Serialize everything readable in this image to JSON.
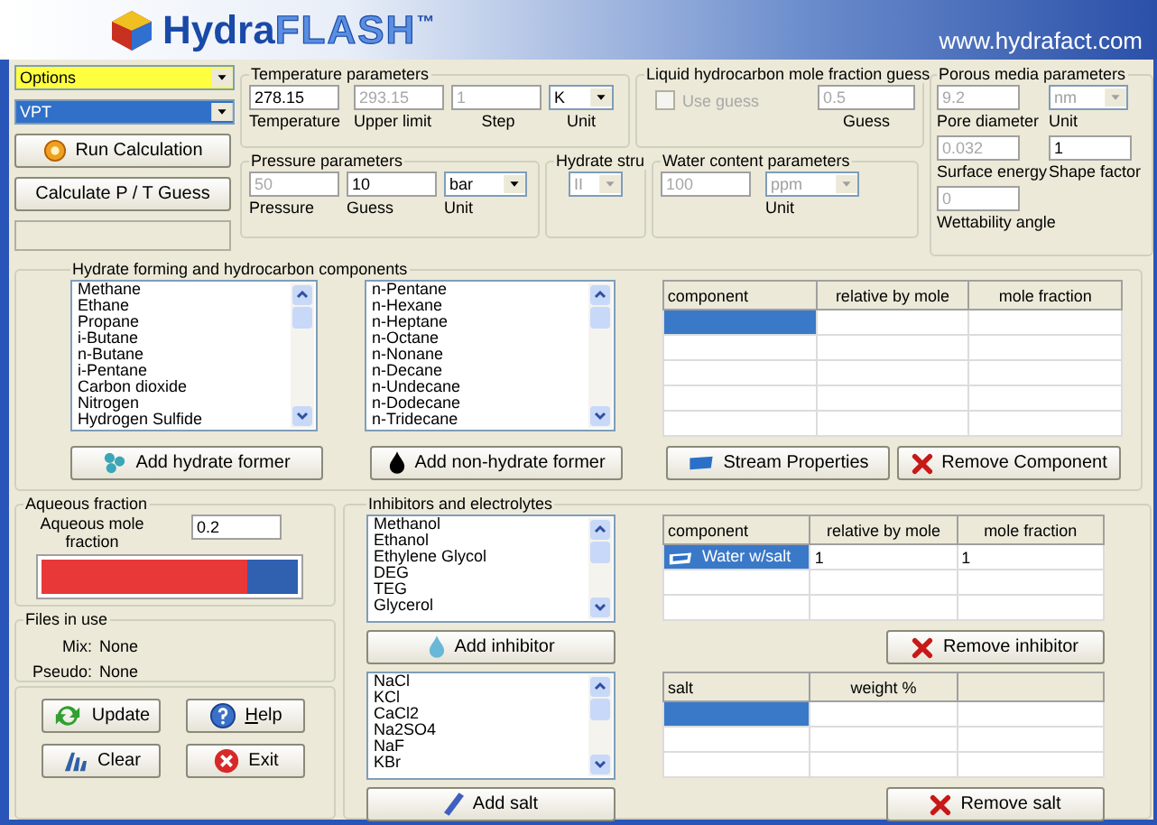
{
  "header": {
    "logo_bold": "Hydra",
    "logo_outline": "FLASH",
    "trademark": "™",
    "url": "www.hydrafact.com"
  },
  "sidebar": {
    "dropdowns": [
      {
        "kind": "options",
        "value": "Options",
        "selected": false
      },
      {
        "kind": "mode",
        "value": "VPT",
        "selected": true
      }
    ],
    "buttons": [
      "Run Calculation",
      "Calculate P / T Guess"
    ]
  },
  "temperature": {
    "title": "Temperature parameters",
    "fields": [
      {
        "value": "278.15",
        "label": "Temperature",
        "disabled": false
      },
      {
        "value": "293.15",
        "label": "Upper limit",
        "disabled": true
      },
      {
        "value": "1",
        "label": "Step",
        "disabled": true
      }
    ],
    "unit": {
      "value": "K",
      "label": "Unit",
      "disabled": false
    }
  },
  "liquid_guess": {
    "title": "Liquid hydrocarbon mole fraction guess",
    "checkbox": {
      "label": "Use guess",
      "checked": false,
      "disabled": true
    },
    "field": {
      "value": "0.5",
      "label": "Guess",
      "disabled": true
    }
  },
  "porous_media": {
    "title": "Porous media parameters",
    "fields": [
      {
        "value": "9.2",
        "label": "Pore diameter",
        "kind": "input",
        "disabled": true
      },
      {
        "value": "nm",
        "label": "Unit",
        "kind": "dropdown",
        "disabled": true
      },
      {
        "value": "0.032",
        "label": "Surface energy",
        "kind": "input",
        "disabled": true
      },
      {
        "value": "1",
        "label": "Shape factor",
        "kind": "input",
        "disabled": false
      },
      {
        "value": "0",
        "label": "Wettability angle",
        "kind": "input",
        "disabled": true
      }
    ]
  },
  "pressure": {
    "title": "Pressure parameters",
    "fields": [
      {
        "value": "50",
        "label": "Pressure",
        "disabled": true
      },
      {
        "value": "10",
        "label": "Guess",
        "disabled": false
      }
    ],
    "unit": {
      "value": "bar",
      "label": "Unit",
      "disabled": false
    }
  },
  "hydrate_structure": {
    "title": "Hydrate stru",
    "dropdown": {
      "value": "II",
      "disabled": true
    }
  },
  "water_content": {
    "title": "Water content parameters",
    "field": {
      "value": "100",
      "disabled": true
    },
    "unit": {
      "value": "ppm",
      "label": "Unit",
      "disabled": true
    }
  },
  "components": {
    "title": "Hydrate forming and hydrocarbon  components",
    "hydrate_formers": [
      "Methane",
      "Ethane",
      "Propane",
      "i-Butane",
      "n-Butane",
      "i-Pentane",
      "Carbon dioxide",
      "Nitrogen",
      "Hydrogen Sulfide"
    ],
    "non_hydrate_formers": [
      "n-Pentane",
      "n-Hexane",
      "n-Heptane",
      "n-Octane",
      "n-Nonane",
      "n-Decane",
      "n-Undecane",
      "n-Dodecane",
      "n-Tridecane"
    ],
    "table": {
      "columns": [
        "component",
        "relative by mole",
        "mole fraction"
      ],
      "rows": [
        {
          "selected": true
        },
        {
          "selected": false
        },
        {
          "selected": false
        },
        {
          "selected": false
        },
        {
          "selected": false
        }
      ]
    },
    "buttons": [
      "Add hydrate former",
      "Add non-hydrate former",
      "Stream Properties",
      "Remove Component"
    ]
  },
  "aqueous": {
    "title": "Aqueous fraction",
    "label": "Aqueous mole fraction",
    "value": "0.2",
    "level": 0.8
  },
  "files": {
    "title": "Files in use",
    "items": [
      {
        "label": "Mix:",
        "value": "None"
      },
      {
        "label": "Pseudo:",
        "value": "None"
      }
    ]
  },
  "actions": [
    {
      "label": "Update",
      "mnemonic": false
    },
    {
      "label": "Help",
      "mnemonic": true
    },
    {
      "label": "Clear",
      "mnemonic": false
    },
    {
      "label": "Exit",
      "mnemonic": false
    }
  ],
  "inhibitors": {
    "title": "Inhibitors and electrolytes",
    "inhibitor_list": [
      "Methanol",
      "Ethanol",
      "Ethylene Glycol",
      "DEG",
      "TEG",
      "Glycerol"
    ],
    "inhibitor_button": "Add inhibitor",
    "inhibitor_table": {
      "columns": [
        "component",
        "relative by mole",
        "mole fraction"
      ],
      "extra_blank_column": false,
      "rows": [
        {
          "cells": [
            "Water w/salt",
            "1",
            "1"
          ],
          "selected": true
        },
        {
          "selected": false
        },
        {
          "selected": false
        }
      ]
    },
    "remove_inhibitor": "Remove inhibitor",
    "salt_list": [
      "NaCl",
      "KCl",
      "CaCl2",
      "Na2SO4",
      "NaF",
      "KBr"
    ],
    "salt_button": "Add salt",
    "salt_table": {
      "columns": [
        "salt",
        "weight %"
      ],
      "extra_blank_column": true,
      "rows": [
        {
          "selected": true
        },
        {
          "selected": false
        },
        {
          "selected": false
        }
      ]
    },
    "remove_salt": "Remove salt"
  }
}
